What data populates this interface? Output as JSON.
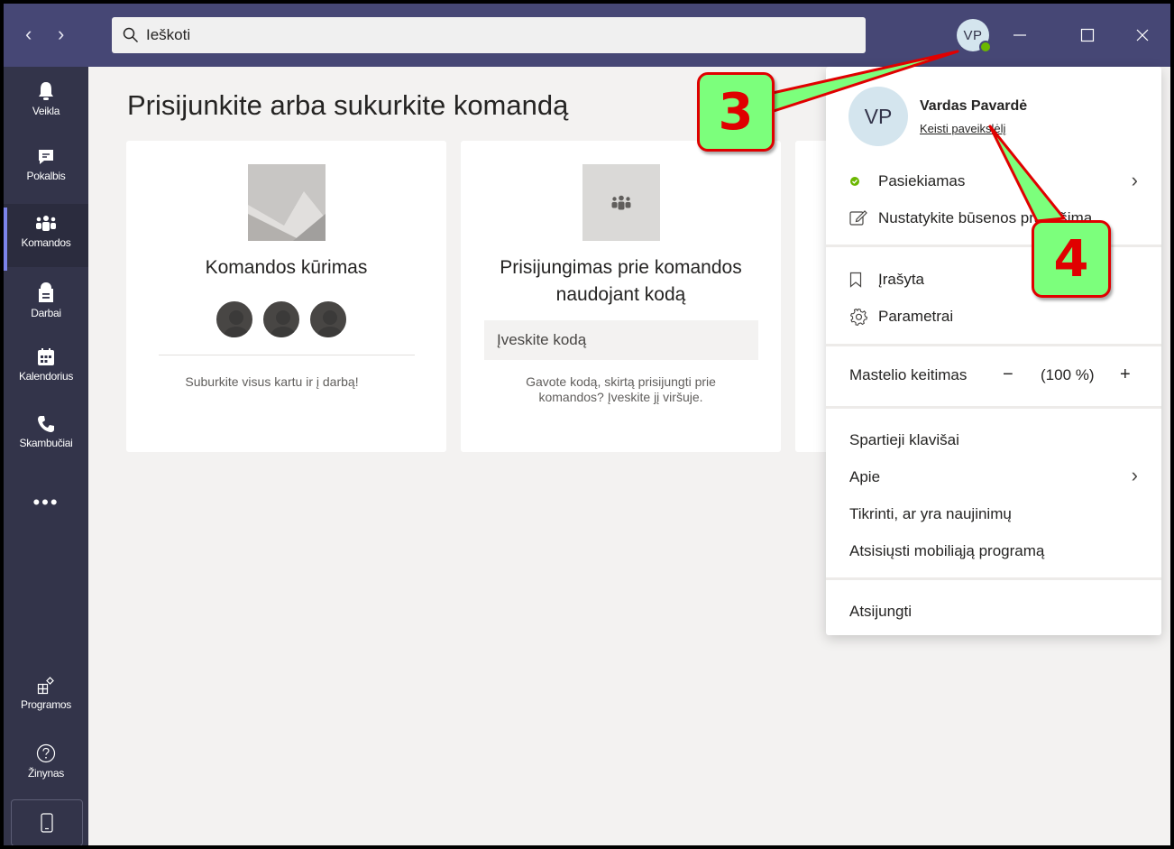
{
  "titlebar": {
    "back_icon": "chevron-left-icon",
    "forward_icon": "chevron-right-icon",
    "search_placeholder": "Ieškoti",
    "avatar_initials": "VP",
    "status_color": "#6bb700",
    "minimize_icon": "minimize-icon",
    "maximize_icon": "maximize-icon",
    "close_icon": "close-icon",
    "bar_color": "#464775"
  },
  "rail": {
    "items": [
      {
        "label": "Veikla",
        "icon": "bell-icon"
      },
      {
        "label": "Pokalbis",
        "icon": "chat-icon"
      },
      {
        "label": "Komandos",
        "icon": "teams-icon",
        "active": true
      },
      {
        "label": "Darbai",
        "icon": "assignments-icon"
      },
      {
        "label": "Kalendorius",
        "icon": "calendar-icon"
      },
      {
        "label": "Skambučiai",
        "icon": "phone-icon"
      }
    ],
    "more_label": "•••",
    "bottom": [
      {
        "label": "Programos",
        "icon": "apps-icon"
      },
      {
        "label": "Žinynas",
        "icon": "help-icon"
      }
    ],
    "device_icon": "mobile-device-icon",
    "active_color": "#7b83eb"
  },
  "main": {
    "title": "Prisijunkite arba sukurkite komandą",
    "create_card": {
      "title": "Komandos kūrimas",
      "description": "Suburkite visus kartu ir į darbą!"
    },
    "join_card": {
      "title_line1": "Prisijungimas prie komandos",
      "title_line2": "naudojant kodą",
      "input_placeholder": "Įveskite kodą",
      "description_line1": "Gavote kodą, skirtą prisijungti prie",
      "description_line2": "komandos? Įveskite jį viršuje."
    }
  },
  "menu": {
    "avatar_initials": "VP",
    "name": "Vardas Pavardė",
    "change_picture": "Keisti paveikslėlį",
    "status": "Pasiekiamas",
    "status_message": "Nustatykite būsenos pranešimą",
    "saved": "Įrašyta",
    "settings": "Parametrai",
    "zoom_label": "Mastelio keitimas",
    "zoom_minus": "−",
    "zoom_value": "(100 %)",
    "zoom_plus": "+",
    "shortcuts": "Spartieji klavišai",
    "about": "Apie",
    "check_updates": "Tikrinti, ar yra naujinimų",
    "download_mobile": "Atsisiųsti mobiliąją programą",
    "sign_out": "Atsijungti"
  },
  "annotations": {
    "callout_3": "3",
    "callout_4": "4",
    "fill_color": "#7cff7c",
    "border_color": "#e00000"
  }
}
